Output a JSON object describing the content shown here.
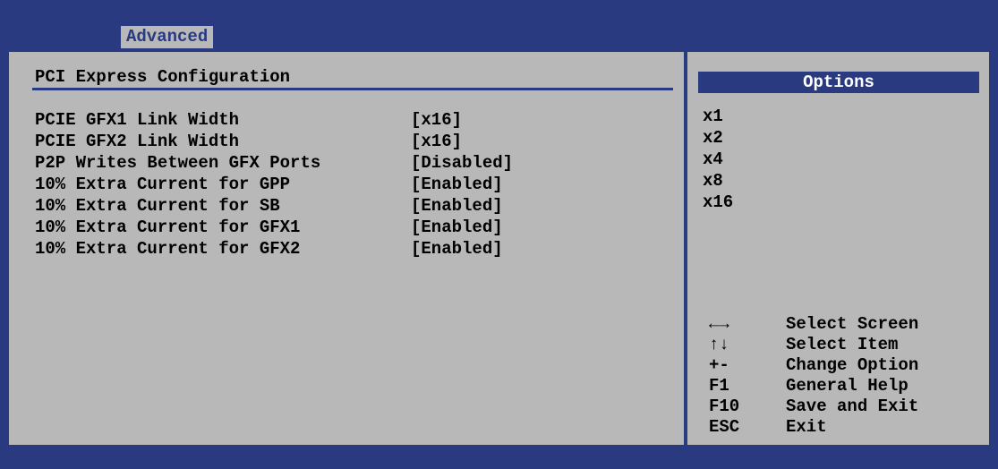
{
  "header": {
    "tab_label": "Advanced"
  },
  "main": {
    "title": "PCI Express Configuration",
    "settings": [
      {
        "label": "PCIE GFX1 Link Width",
        "value": "[x16]"
      },
      {
        "label": "PCIE GFX2 Link Width",
        "value": "[x16]"
      },
      {
        "label": "P2P Writes Between GFX Ports",
        "value": "[Disabled]"
      },
      {
        "label": "10% Extra Current for GPP",
        "value": "[Enabled]"
      },
      {
        "label": "10% Extra Current for SB",
        "value": "[Enabled]"
      },
      {
        "label": "10% Extra Current for GFX1",
        "value": "[Enabled]"
      },
      {
        "label": "10% Extra Current for GFX2",
        "value": "[Enabled]"
      }
    ]
  },
  "options": {
    "header": "Options",
    "items": [
      "x1",
      "x2",
      "x4",
      "x8",
      "x16"
    ]
  },
  "help": [
    {
      "key": "←→",
      "desc": "Select Screen",
      "icon": "left-right-arrows-icon"
    },
    {
      "key": "↑↓",
      "desc": "Select Item",
      "icon": "up-down-arrows-icon"
    },
    {
      "key": "+-",
      "desc": "Change Option"
    },
    {
      "key": "F1",
      "desc": "General Help"
    },
    {
      "key": "F10",
      "desc": "Save and Exit"
    },
    {
      "key": "ESC",
      "desc": "Exit"
    }
  ],
  "colors": {
    "background": "#2a3a80",
    "panel": "#b8b8b8",
    "text": "#000000",
    "accent_text": "#ffffff"
  }
}
